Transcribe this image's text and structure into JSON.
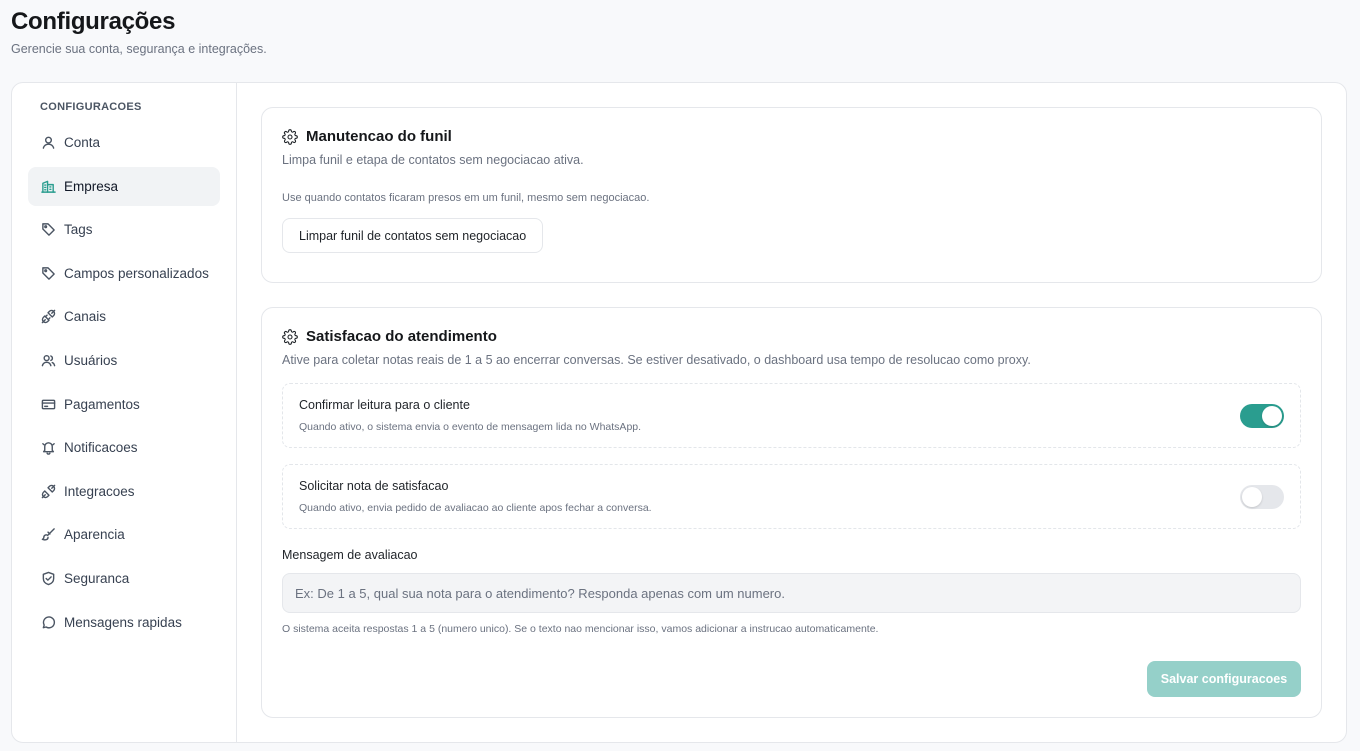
{
  "header": {
    "title": "Configurações",
    "subtitle": "Gerencie sua conta, segurança e integrações."
  },
  "sidebar": {
    "heading": "CONFIGURACOES",
    "items": [
      {
        "label": "Conta",
        "icon": "user-icon",
        "active": false
      },
      {
        "label": "Empresa",
        "icon": "building-icon",
        "active": true
      },
      {
        "label": "Tags",
        "icon": "tag-icon",
        "active": false
      },
      {
        "label": "Campos personalizados",
        "icon": "tag-icon",
        "active": false
      },
      {
        "label": "Canais",
        "icon": "plug-icon",
        "active": false
      },
      {
        "label": "Usuários",
        "icon": "users-icon",
        "active": false
      },
      {
        "label": "Pagamentos",
        "icon": "credit-card-icon",
        "active": false
      },
      {
        "label": "Notificacoes",
        "icon": "bell-icon",
        "active": false
      },
      {
        "label": "Integracoes",
        "icon": "plug-icon",
        "active": false
      },
      {
        "label": "Aparencia",
        "icon": "brush-icon",
        "active": false
      },
      {
        "label": "Seguranca",
        "icon": "shield-icon",
        "active": false
      },
      {
        "label": "Mensagens rapidas",
        "icon": "message-circle-icon",
        "active": false
      }
    ]
  },
  "funnel": {
    "icon": "gear-icon",
    "title": "Manutencao do funil",
    "description": "Limpa funil e etapa de contatos sem negociacao ativa.",
    "note": "Use quando contatos ficaram presos em um funil, mesmo sem negociacao.",
    "button_label": "Limpar funil de contatos sem negociacao"
  },
  "satisfaction": {
    "icon": "gear-icon",
    "title": "Satisfacao do atendimento",
    "description": "Ative para coletar notas reais de 1 a 5 ao encerrar conversas. Se estiver desativado, o dashboard usa tempo de resolucao como proxy.",
    "toggles": [
      {
        "label": "Confirmar leitura para o cliente",
        "help": "Quando ativo, o sistema envia o evento de mensagem lida no WhatsApp.",
        "on": true
      },
      {
        "label": "Solicitar nota de satisfacao",
        "help": "Quando ativo, envia pedido de avaliacao ao cliente apos fechar a conversa.",
        "on": false
      }
    ],
    "message_label": "Mensagem de avaliacao",
    "message_value": "",
    "message_placeholder": "Ex: De 1 a 5, qual sua nota para o atendimento? Responda apenas com um numero.",
    "message_help": "O sistema aceita respostas 1 a 5 (numero unico). Se o texto nao mencionar isso, vamos adicionar a instrucao automaticamente.",
    "save_label": "Salvar configuracoes"
  },
  "colors": {
    "accent": "#2a9d8f",
    "accent_disabled": "#95d0c9"
  }
}
